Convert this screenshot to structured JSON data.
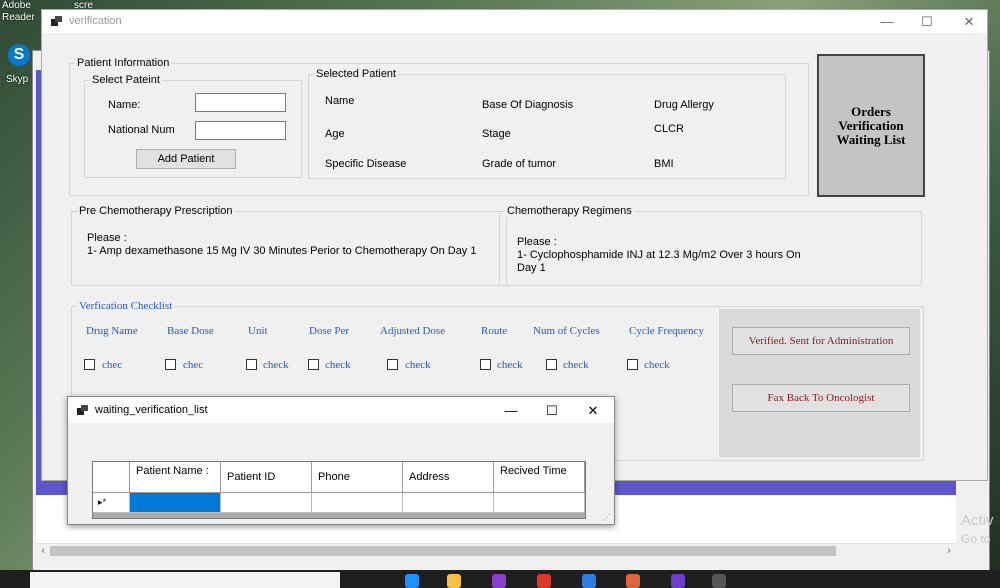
{
  "desktop": {
    "icon_labels": [
      "Adobe",
      "Reader",
      "scre",
      "Skyp"
    ],
    "watermark_line1": "Activ",
    "watermark_line2": "Go to"
  },
  "main_window": {
    "title": "verification",
    "patient_information": {
      "title": "Patient Information",
      "select_patient": {
        "title": "Select Pateint",
        "name_label": "Name:",
        "name_value": "",
        "national_num_label": "National Num",
        "national_num_value": "",
        "add_button": "Add Patient"
      },
      "selected_patient": {
        "title": "Selected Patient",
        "col1": [
          "Name",
          "Age",
          "Specific Disease"
        ],
        "col2": [
          "Base Of Diagnosis",
          "Stage",
          "Grade of tumor"
        ],
        "col3": [
          "Drug Allergy",
          "CLCR",
          "BMI"
        ]
      }
    },
    "orders_button": [
      "Orders",
      "Verification",
      "Waiting List"
    ],
    "pre_chemo": {
      "title": "Pre Chemotherapy Prescription",
      "line1": "Please :",
      "line2": "1- Amp dexamethasone 15 Mg IV 30 Minutes Perior to Chemotherapy On Day 1"
    },
    "chemo_regimens": {
      "title": "Chemotherapy Regimens",
      "line1": "Please :",
      "line2": "1- Cyclophosphamide INJ at 12.3 Mg/m2 Over 3 hours On",
      "line3": "Day 1"
    },
    "checklist": {
      "title": "Verfication Checklist",
      "columns": [
        "Drug Name",
        "Base Dose",
        "Unit",
        "Dose Per",
        "Adjusted Dose",
        "Route",
        "Num of Cycles",
        "Cycle  Frequency"
      ],
      "checks": [
        "chec",
        "chec",
        "check",
        "check",
        "check",
        "check",
        "check",
        "check"
      ],
      "verified_button": "Verified. Sent for Administration",
      "fax_button": "Fax Back To Oncologist"
    }
  },
  "waiting_dialog": {
    "title": "waiting_verification_list",
    "columns": [
      "Patient Name :",
      "Patient ID",
      "Phone",
      "Address",
      "Recived Time"
    ],
    "new_row_marker": "▸*"
  }
}
